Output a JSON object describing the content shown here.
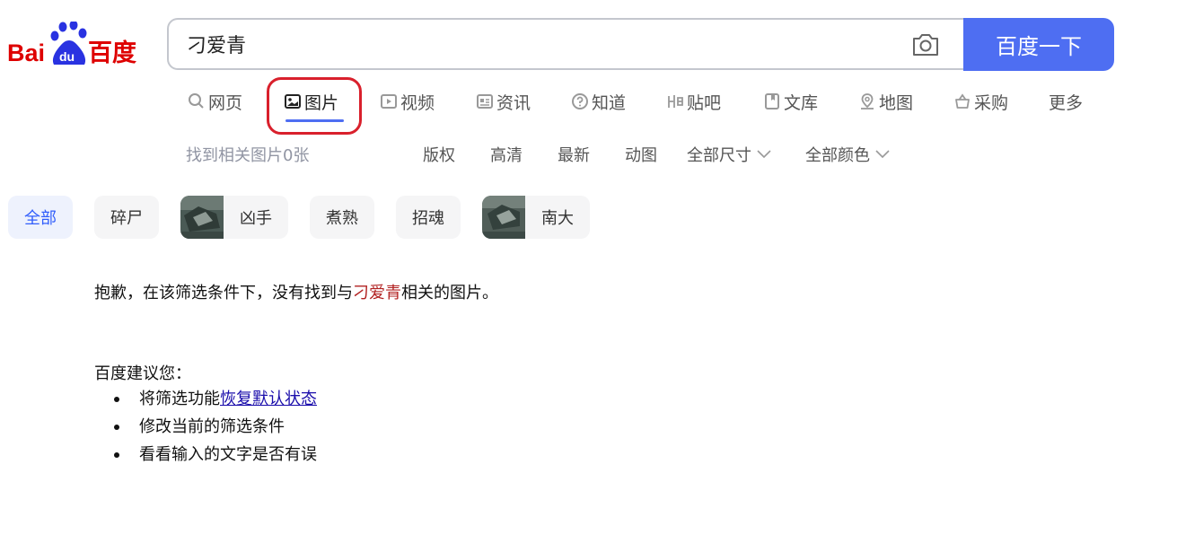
{
  "logo": {
    "text_left": "Bai",
    "text_paw": "du",
    "text_right": "百度"
  },
  "search": {
    "query": "刁爱青",
    "button_label": "百度一下"
  },
  "nav": {
    "tabs": [
      {
        "label": "网页",
        "icon": "search-icon"
      },
      {
        "label": "图片",
        "icon": "image-icon",
        "active": true
      },
      {
        "label": "视频",
        "icon": "video-icon"
      },
      {
        "label": "资讯",
        "icon": "news-icon"
      },
      {
        "label": "知道",
        "icon": "question-icon"
      },
      {
        "label": "贴吧",
        "icon": "tieba-icon"
      },
      {
        "label": "文库",
        "icon": "doc-icon"
      },
      {
        "label": "地图",
        "icon": "map-pin-icon"
      },
      {
        "label": "采购",
        "icon": "basket-icon"
      },
      {
        "label": "更多"
      }
    ],
    "highlight_color": "#d9202c"
  },
  "toolbar": {
    "result_count": "找到相关图片0张",
    "filters": [
      "版权",
      "高清",
      "最新",
      "动图",
      "全部尺寸",
      "全部颜色"
    ]
  },
  "chips": [
    {
      "label": "全部",
      "active": true
    },
    {
      "label": "碎尸"
    },
    {
      "label": "凶手",
      "thumbnail": true
    },
    {
      "label": "煮熟"
    },
    {
      "label": "招魂"
    },
    {
      "label": "南大",
      "thumbnail": true
    }
  ],
  "message": {
    "prefix": "抱歉，在该筛选条件下，没有找到与",
    "keyword": "刁爱青",
    "suffix": "相关的图片。"
  },
  "suggestions": {
    "title": "百度建议您：",
    "items": [
      {
        "text": "将筛选功能",
        "link": "恢复默认状态"
      },
      {
        "text": "修改当前的筛选条件"
      },
      {
        "text": "看看输入的文字是否有误"
      }
    ]
  },
  "colors": {
    "brand_blue": "#4e6ef2",
    "brand_red": "#de0000",
    "chip_active": "#315efb"
  }
}
